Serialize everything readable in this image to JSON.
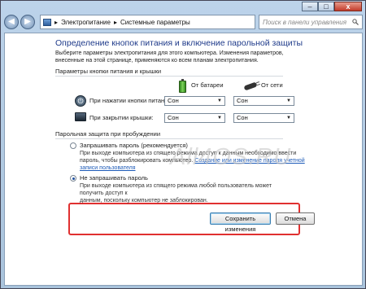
{
  "window": {
    "controls": {
      "minimize": "–",
      "maximize": "□",
      "close": "x"
    }
  },
  "address": {
    "back": "◀",
    "forward": "▶",
    "crumb1": "Электропитание",
    "crumb2": "Системные параметры",
    "separator": "▸",
    "search_placeholder": "Поиск в панели управления",
    "search_icon": "search-icon"
  },
  "page": {
    "title": "Определение кнопок питания и включение парольной защиты",
    "intro": "Выберите параметры электропитания для этого компьютера. Изменения параметров, внесенные на этой странице, применяются ко всем планам электропитания."
  },
  "power_buttons": {
    "group_label": "Параметры кнопки питания и крышки",
    "col_battery": "От батареи",
    "col_ac": "От сети",
    "rows": [
      {
        "label": "При нажатии кнопки питания:",
        "battery": "Сон",
        "ac": "Сон"
      },
      {
        "label": "При закрытии крышки:",
        "battery": "Сон",
        "ac": "Сон"
      }
    ],
    "arrow": "▼"
  },
  "password": {
    "group_label": "Парольная защита при пробуждении",
    "options": [
      {
        "label": "Запрашивать пароль (рекомендуется)",
        "desc_line1": "При выходе компьютера из спящего режима доступ к данным необходимо ввести",
        "desc_line2": "пароль, чтобы разблокировать компьютер.",
        "link": "Создание или изменение пароля учетной записи пользователя",
        "selected": false
      },
      {
        "label": "Не запрашивать пароль",
        "desc_line1": "При выходе компьютера из спящего режима любой пользователь может получить доступ к",
        "desc_line2": "данным, поскольку компьютер не заблокирован.",
        "selected": true
      }
    ]
  },
  "watermark": "All4OS.RU",
  "buttons": {
    "save": "Сохранить изменения",
    "cancel": "Отмена"
  },
  "colors": {
    "title_blue": "#1e3a8a",
    "highlight_red": "#e03030",
    "link_blue": "#1e5bb8"
  }
}
